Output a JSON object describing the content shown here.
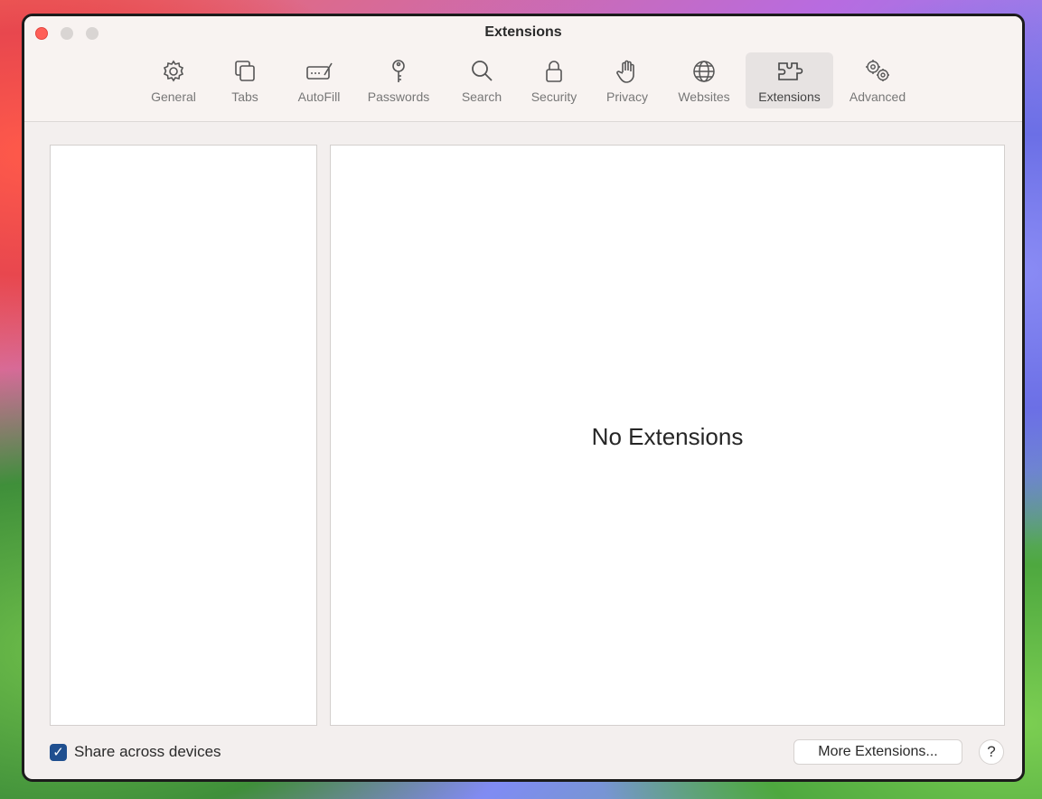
{
  "window": {
    "title": "Extensions"
  },
  "toolbar": {
    "tabs": [
      {
        "label": "General",
        "icon": "gear-icon"
      },
      {
        "label": "Tabs",
        "icon": "tabs-icon"
      },
      {
        "label": "AutoFill",
        "icon": "autofill-icon"
      },
      {
        "label": "Passwords",
        "icon": "key-icon"
      },
      {
        "label": "Search",
        "icon": "search-icon"
      },
      {
        "label": "Security",
        "icon": "lock-icon"
      },
      {
        "label": "Privacy",
        "icon": "hand-icon"
      },
      {
        "label": "Websites",
        "icon": "globe-icon"
      },
      {
        "label": "Extensions",
        "icon": "puzzle-icon",
        "selected": true
      },
      {
        "label": "Advanced",
        "icon": "gears-icon"
      }
    ]
  },
  "main": {
    "empty_message": "No Extensions"
  },
  "footer": {
    "share_label": "Share across devices",
    "share_checked": true,
    "more_button": "More Extensions...",
    "help_button": "?"
  },
  "colors": {
    "close": "#ff5f57",
    "checkbox": "#1f4f8f",
    "window_bg": "#f3efee"
  }
}
